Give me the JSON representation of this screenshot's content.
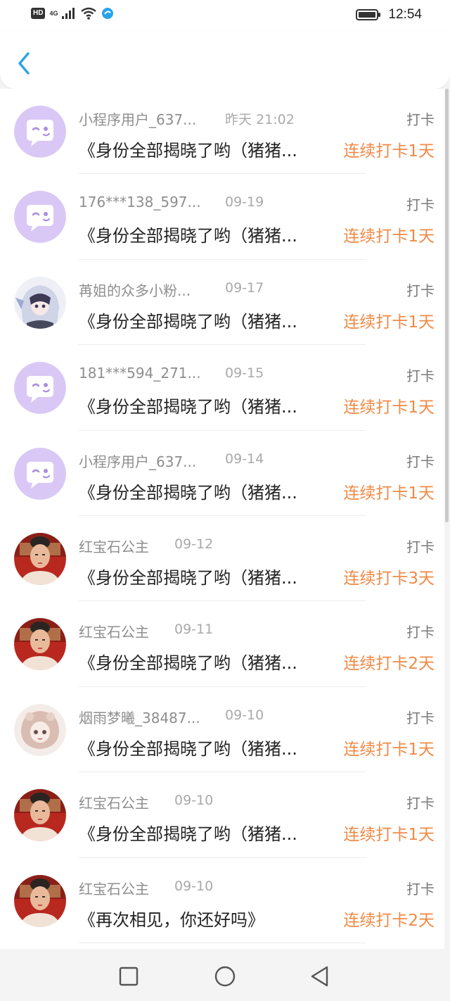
{
  "status_bar": {
    "hd": "HD",
    "net": "4G",
    "time": "12:54",
    "icons": [
      "signal-icon",
      "wifi-icon",
      "app-notification-icon",
      "battery-icon"
    ]
  },
  "header": {
    "back_icon": "chevron-left-icon",
    "accent": "#2aa3e8"
  },
  "list": {
    "rows": [
      {
        "name": "小程序用户_637...",
        "date": "昨天 21:02",
        "type": "打卡",
        "title": "《身份全部揭晓了哟（猪猪...",
        "streak": "连续打卡1天",
        "avatar": "wink-face-avatar"
      },
      {
        "name": "176***138_597...",
        "date": "09-19",
        "type": "打卡",
        "title": "《身份全部揭晓了哟（猪猪...",
        "streak": "连续打卡1天",
        "avatar": "wink-face-avatar"
      },
      {
        "name": "苒姐的众多小粉...",
        "date": "09-17",
        "type": "打卡",
        "title": "《身份全部揭晓了哟（猪猪...",
        "streak": "连续打卡1天",
        "avatar": "anime-girl-avatar"
      },
      {
        "name": "181***594_271...",
        "date": "09-15",
        "type": "打卡",
        "title": "《身份全部揭晓了哟（猪猪...",
        "streak": "连续打卡1天",
        "avatar": "wink-face-avatar"
      },
      {
        "name": "小程序用户_637...",
        "date": "09-14",
        "type": "打卡",
        "title": "《身份全部揭晓了哟（猪猪...",
        "streak": "连续打卡1天",
        "avatar": "wink-face-avatar"
      },
      {
        "name": "红宝石公主",
        "date": "09-12",
        "type": "打卡",
        "title": "《身份全部揭晓了哟（猪猪...",
        "streak": "连续打卡3天",
        "avatar": "portrait-avatar"
      },
      {
        "name": "红宝石公主",
        "date": "09-11",
        "type": "打卡",
        "title": "《身份全部揭晓了哟（猪猪...",
        "streak": "连续打卡2天",
        "avatar": "portrait-avatar"
      },
      {
        "name": "烟雨梦曦_38487...",
        "date": "09-10",
        "type": "打卡",
        "title": "《身份全部揭晓了哟（猪猪...",
        "streak": "连续打卡1天",
        "avatar": "doll-avatar"
      },
      {
        "name": "红宝石公主",
        "date": "09-10",
        "type": "打卡",
        "title": "《身份全部揭晓了哟（猪猪...",
        "streak": "连续打卡1天",
        "avatar": "portrait-avatar"
      },
      {
        "name": "红宝石公主",
        "date": "09-10",
        "type": "打卡",
        "title": "《再次相见，你还好吗》",
        "streak": "连续打卡2天",
        "avatar": "portrait-avatar"
      }
    ]
  },
  "colors": {
    "streak": "#f08a46",
    "wink_avatar_bg": "#d9c8f5",
    "wink_avatar_bubble": "#ffffff",
    "wink_avatar_eye": "#a98ee0"
  },
  "nav": {
    "icons": [
      "recent-apps-icon",
      "home-icon",
      "back-triangle-icon"
    ]
  }
}
